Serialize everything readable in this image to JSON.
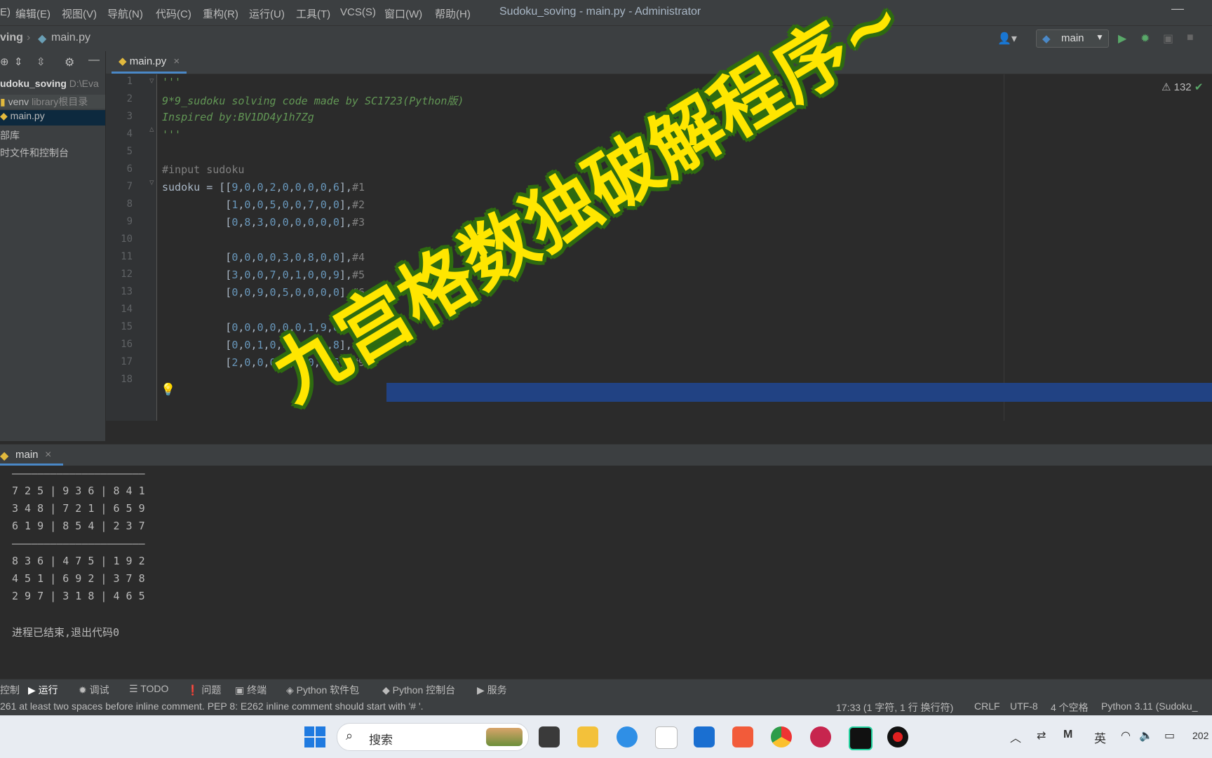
{
  "menubar": {
    "items": [
      "E)",
      "编辑(E)",
      "视图(V)",
      "导航(N)",
      "代码(C)",
      "重构(R)",
      "运行(U)",
      "工具(T)",
      "VCS(S)",
      "窗口(W)",
      "帮助(H)"
    ],
    "window_title": "Sudoku_soving - main.py - Administrator",
    "minimize": "—"
  },
  "navbar": {
    "project_crumb": "ving",
    "file_crumb": "main.py",
    "run_config": "main"
  },
  "project_panel": {
    "root_name": "udoku_soving",
    "root_path": "D:\\Eva",
    "venv": "venv",
    "venv_note": "library根目录",
    "main_file": "main.py",
    "external_libs": "部库",
    "scratches": "时文件和控制台"
  },
  "editor": {
    "tab_label": "main.py",
    "warning_count": "132",
    "line_numbers": [
      "1",
      "2",
      "3",
      "4",
      "5",
      "6",
      "7",
      "8",
      "9",
      "10",
      "11",
      "12",
      "13",
      "14",
      "15",
      "16",
      "17",
      "18"
    ],
    "lines": [
      {
        "t": "'''",
        "c": "doc"
      },
      {
        "t": "9*9_sudoku solving code made by SC1723(Python版)",
        "c": "doc"
      },
      {
        "t": "Inspired by:BV1DD4y1h7Zg",
        "c": "doc"
      },
      {
        "t": "'''",
        "c": "doc"
      },
      {
        "t": "",
        "c": ""
      },
      {
        "t": "#input sudoku",
        "c": "cmt"
      },
      {
        "t": "sudoku = [[9,0,0,2,0,0,0,0,6],#1",
        "c": ""
      },
      {
        "t": "          [1,0,0,5,0,0,7,0,0],#2",
        "c": ""
      },
      {
        "t": "          [0,8,3,0,0,0,0,0,0],#3",
        "c": ""
      },
      {
        "t": "",
        "c": ""
      },
      {
        "t": "          [0,0,0,0,3,0,8,0,0],#4",
        "c": ""
      },
      {
        "t": "          [3,0,0,7,0,1,0,0,9],#5",
        "c": ""
      },
      {
        "t": "          [0,0,9,0,5,0,0,0,0],#6",
        "c": ""
      },
      {
        "t": "",
        "c": ""
      },
      {
        "t": "          [0,0,0,0,0,0,1,9,0],#7",
        "c": ""
      },
      {
        "t": "          [0,0,1,0,0,2,0,0,8],#8",
        "c": ""
      },
      {
        "t": "          [2,0,0,0,0,8,0,0,5]]#9",
        "c": ""
      },
      {
        "t": "",
        "c": ""
      }
    ]
  },
  "run_panel": {
    "tab_label": "main",
    "output": [
      "—————————————————————",
      "7 2 5 | 9 3 6 | 8 4 1",
      "3 4 8 | 7 2 1 | 6 5 9",
      "6 1 9 | 8 5 4 | 2 3 7",
      "—————————————————————",
      "8 3 6 | 4 7 5 | 1 9 2",
      "4 5 1 | 6 9 2 | 3 7 8",
      "2 9 7 | 3 1 8 | 4 6 5",
      "",
      "进程已结束,退出代码0"
    ]
  },
  "tool_tabs": [
    "控制",
    "运行",
    "调试",
    "TODO",
    "问题",
    "终端",
    "Python 软件包",
    "Python 控制台",
    "服务"
  ],
  "statusbar": {
    "message": "261 at least two spaces before inline comment. PEP 8: E262 inline comment should start with '# '.",
    "position": "17:33 (1 字符, 1 行 换行符)",
    "line_sep": "CRLF",
    "encoding": "UTF-8",
    "indent": "4 个空格",
    "interpreter": "Python 3.11 (Sudoku_"
  },
  "taskbar": {
    "search_placeholder": "搜索",
    "ime": "英",
    "clock_partial": "202"
  },
  "overlay_caption": "九宫格数独破解程序~"
}
